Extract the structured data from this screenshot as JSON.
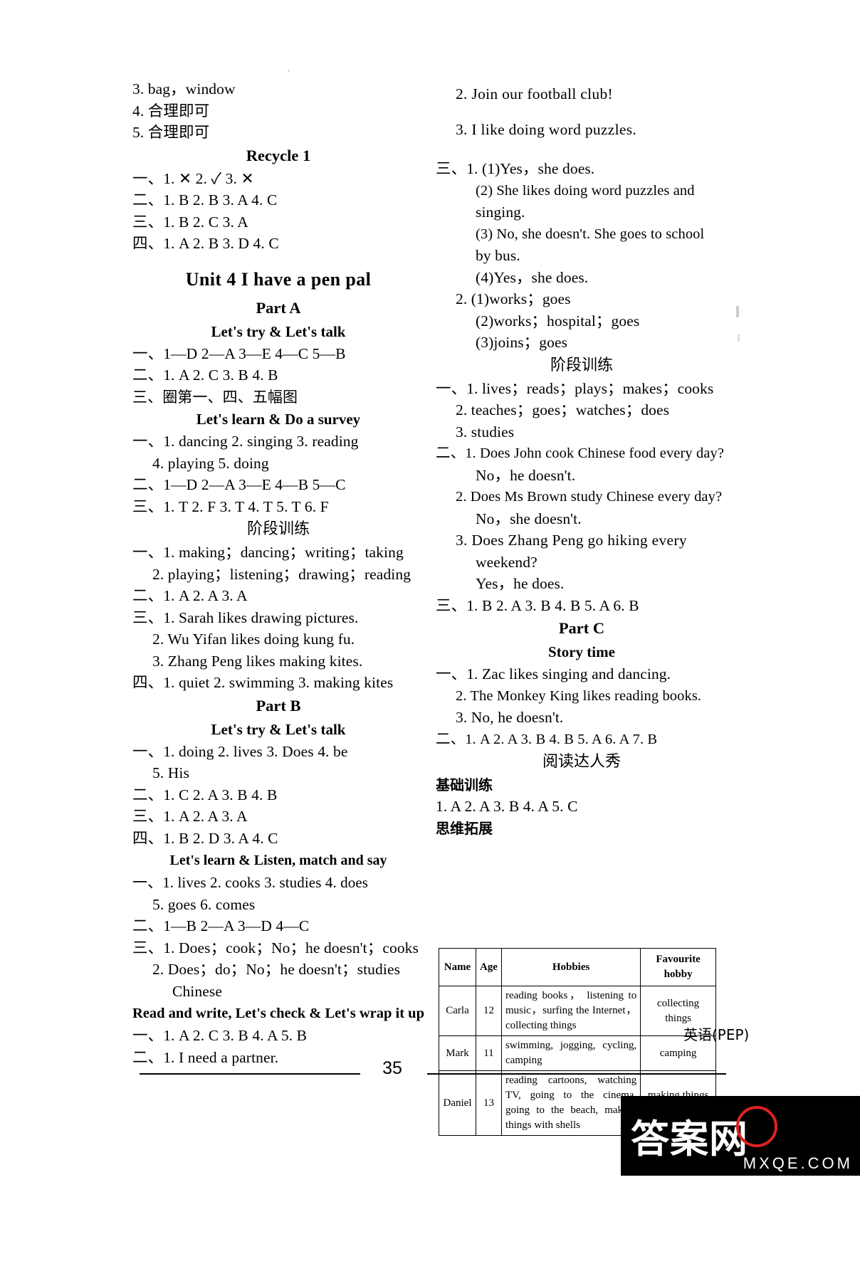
{
  "page": {
    "number": "35",
    "subject_label": "英语(PEP)",
    "watermark_main": "答案网",
    "watermark_sub": "MXQE.COM"
  },
  "left_column": {
    "lines": [
      {
        "type": "answer",
        "text": "3. bag，window"
      },
      {
        "type": "answer",
        "text": "4. 合理即可"
      },
      {
        "type": "answer",
        "text": "5. 合理即可"
      },
      {
        "type": "part_head",
        "text": "Recycle 1"
      },
      {
        "type": "answer",
        "text": "一、1. ✕   2. ✓   3. ✕"
      },
      {
        "type": "answer",
        "text": "二、1. B  2. B  3. A   4. C"
      },
      {
        "type": "answer",
        "text": "三、1. B   2. C   3. A"
      },
      {
        "type": "answer",
        "text": "四、1. A  2. B  3. D   4. C"
      },
      {
        "type": "unit_title",
        "text": "Unit 4   I have a pen pal"
      },
      {
        "type": "part_head",
        "text": "Part A"
      },
      {
        "type": "sub_head",
        "text": "Let's try & Let's talk"
      },
      {
        "type": "answer",
        "text": "一、1—D  2—A  3—E  4—C  5—B"
      },
      {
        "type": "answer",
        "text": "二、1. A   2. C   3. B   4. B"
      },
      {
        "type": "answer_cn",
        "text": "三、圈第一、四、五幅图"
      },
      {
        "type": "sub_head",
        "text": "Let's learn & Do a survey"
      },
      {
        "type": "answer",
        "text": "一、1. dancing   2. singing   3. reading"
      },
      {
        "type": "answer_i1",
        "text": "4. playing   5. doing"
      },
      {
        "type": "answer",
        "text": "二、1—D   2—A   3—E   4—B   5—C"
      },
      {
        "type": "answer",
        "text": "三、1. T   2. F   3. T   4. T   5. T   6. F"
      },
      {
        "type": "cn_head",
        "text": "阶段训练"
      },
      {
        "type": "answer",
        "text": "一、1. making；dancing；writing；taking"
      },
      {
        "type": "answer_i1",
        "text": "2. playing；listening；drawing；reading"
      },
      {
        "type": "answer",
        "text": "二、1. A   2. A   3. A"
      },
      {
        "type": "answer",
        "text": "三、1. Sarah likes drawing pictures."
      },
      {
        "type": "answer_i1",
        "text": "2. Wu Yifan likes doing kung fu."
      },
      {
        "type": "answer_i1",
        "text": "3. Zhang Peng likes making kites."
      },
      {
        "type": "answer",
        "text": "四、1. quiet   2. swimming   3. making kites"
      },
      {
        "type": "part_head",
        "text": "Part B"
      },
      {
        "type": "sub_head",
        "text": "Let's try & Let's talk"
      },
      {
        "type": "answer",
        "text": "一、1. doing   2. lives   3. Does   4. be"
      },
      {
        "type": "answer_i1",
        "text": "5. His"
      },
      {
        "type": "answer",
        "text": "二、1. C   2. A   3. B   4. B"
      },
      {
        "type": "answer",
        "text": "三、1. A   2. A   3. A"
      },
      {
        "type": "answer",
        "text": "四、1. B   2. D   3. A   4. C"
      },
      {
        "type": "sub_head",
        "text": "Let's learn & Listen, match and say"
      },
      {
        "type": "answer",
        "text": "一、1. lives   2. cooks   3. studies   4. does"
      },
      {
        "type": "answer_i1",
        "text": "5. goes   6. comes"
      },
      {
        "type": "answer",
        "text": "二、1—B   2—A   3—D   4—C"
      },
      {
        "type": "answer",
        "text": "三、1. Does；cook；No；he doesn't；cooks"
      },
      {
        "type": "answer_i1",
        "text": "2. Does；do；No；he doesn't；studies"
      },
      {
        "type": "answer_i2",
        "text": "Chinese"
      },
      {
        "type": "sub_head_left",
        "text": "Read and write, Let's check & Let's wrap it up"
      },
      {
        "type": "answer",
        "text": "一、1. A   2. C   3. B   4. A   5. B"
      },
      {
        "type": "answer",
        "text": "二、1. I   need   a   partner."
      }
    ]
  },
  "right_column": {
    "lines": [
      {
        "type": "answer_spread",
        "text": "2. Join   our   football   club!"
      },
      {
        "type": "answer_spread",
        "text": "3. I   like   doing   word   puzzles."
      },
      {
        "type": "answer",
        "text": "三、1. (1)Yes，she does."
      },
      {
        "type": "answer_i2",
        "text": "(2) She likes doing word puzzles and"
      },
      {
        "type": "answer_i2b",
        "text": "singing."
      },
      {
        "type": "answer_i2",
        "text": "(3) No, she doesn't. She goes to school"
      },
      {
        "type": "answer_i2b",
        "text": "by bus."
      },
      {
        "type": "answer_i2",
        "text": "(4)Yes，she does."
      },
      {
        "type": "answer_i1",
        "text": "2. (1)works；goes"
      },
      {
        "type": "answer_i2",
        "text": "(2)works；hospital；goes"
      },
      {
        "type": "answer_i2",
        "text": "(3)joins；goes"
      },
      {
        "type": "cn_head",
        "text": "阶段训练"
      },
      {
        "type": "answer",
        "text": "一、1. lives；reads；plays；makes；cooks"
      },
      {
        "type": "answer_i1",
        "text": "2. teaches；goes；watches；does"
      },
      {
        "type": "answer_i1",
        "text": "3. studies"
      },
      {
        "type": "answer",
        "text": "二、1. Does John cook Chinese food every day?"
      },
      {
        "type": "answer_i1b",
        "text": "No，he doesn't."
      },
      {
        "type": "answer_i1",
        "text": "2. Does Ms Brown study Chinese every day?"
      },
      {
        "type": "answer_i1b",
        "text": "No，she doesn't."
      },
      {
        "type": "answer_i1",
        "text": "3. Does  Zhang  Peng  go  hiking  every"
      },
      {
        "type": "answer_i1b",
        "text": "weekend?"
      },
      {
        "type": "answer_i1b",
        "text": "Yes，he does."
      },
      {
        "type": "answer",
        "text": "三、1. B   2. A   3. B   4. B   5. A   6. B"
      },
      {
        "type": "part_head",
        "text": "Part C"
      },
      {
        "type": "sub_head",
        "text": "Story time"
      },
      {
        "type": "answer",
        "text": "一、1. Zac likes singing and dancing."
      },
      {
        "type": "answer_i1",
        "text": "2. The Monkey King likes reading books."
      },
      {
        "type": "answer_i1",
        "text": "3. No, he doesn't."
      },
      {
        "type": "answer",
        "text": "二、1. A   2. A   3. B   4. B   5. A   6. A   7. B"
      },
      {
        "type": "cn_head",
        "text": "阅读达人秀"
      },
      {
        "type": "cn_bold_left",
        "text": "基础训练"
      },
      {
        "type": "answer",
        "text": "1. A   2. A   3. B   4. A   5. C"
      },
      {
        "type": "cn_bold_left",
        "text": "思维拓展"
      }
    ]
  },
  "hobby_table": {
    "headers": [
      "Name",
      "Age",
      "Hobbies",
      "Favourite hobby"
    ],
    "rows": [
      {
        "name": "Carla",
        "age": "12",
        "hobbies": "reading books， listening to music，surfing the Internet，collecting things",
        "favourite": "collecting things"
      },
      {
        "name": "Mark",
        "age": "11",
        "hobbies": "swimming, jogging, cycling, camping",
        "favourite": "camping"
      },
      {
        "name": "Daniel",
        "age": "13",
        "hobbies": "reading cartoons, watching TV, going to the cinema, going to the beach, making things with shells",
        "favourite": "making things with shells"
      }
    ]
  }
}
